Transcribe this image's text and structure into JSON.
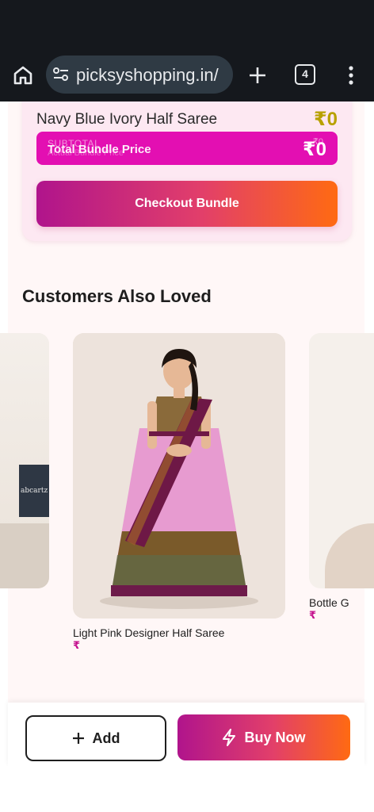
{
  "browser": {
    "url": "picksyshopping.in/",
    "tab_count": "4"
  },
  "bundle": {
    "item_name": "Navy Blue Ivory Half Saree",
    "item_price": "₹0",
    "subtotal_label": "SUBTOTAL",
    "subtotal_strike": "Actual Bundle Price",
    "subtotal_small": "₹0",
    "total_label": "Total Bundle Price",
    "total_price": "₹0",
    "checkout_label": "Checkout Bundle"
  },
  "section_title": "Customers Also Loved",
  "products": [
    {
      "name": "",
      "price": ""
    },
    {
      "name": "Light Pink Designer Half Saree",
      "price": "₹"
    },
    {
      "name": "Bottle G",
      "price": "₹"
    }
  ],
  "left_card_sign": "abcartz",
  "actions": {
    "add_label": "Add",
    "buy_label": "Buy Now"
  },
  "colors": {
    "accent_pink": "#e30fb2",
    "gradient_start": "#b0148c",
    "gradient_end": "#ff6a12",
    "price_gold": "#b8a100"
  }
}
